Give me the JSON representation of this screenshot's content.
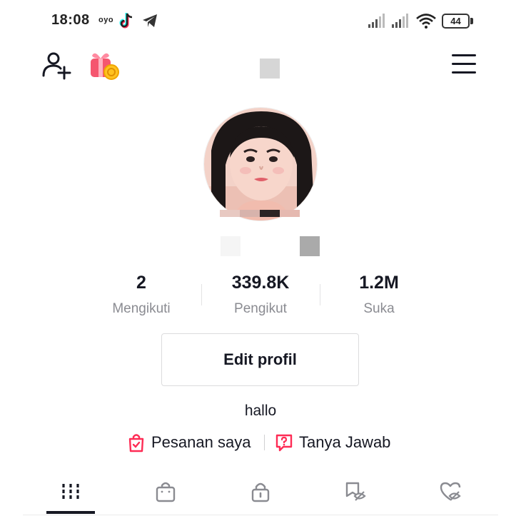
{
  "status_bar": {
    "time": "18:08",
    "carrier_badge": "oyo",
    "battery": "44"
  },
  "profile": {
    "stats": [
      {
        "value": "2",
        "label": "Mengikuti"
      },
      {
        "value": "339.8K",
        "label": "Pengikut"
      },
      {
        "value": "1.2M",
        "label": "Suka"
      }
    ],
    "edit_button": "Edit profil",
    "bio": "hallo",
    "links": [
      {
        "label": "Pesanan saya",
        "icon": "shopping-bag-check-icon"
      },
      {
        "label": "Tanya Jawab",
        "icon": "question-chat-icon"
      }
    ]
  },
  "tabs": [
    {
      "icon": "grid-videos-icon",
      "active": true
    },
    {
      "icon": "shop-bag-icon",
      "active": false
    },
    {
      "icon": "lock-icon",
      "active": false
    },
    {
      "icon": "repost-hidden-icon",
      "active": false
    },
    {
      "icon": "liked-hidden-icon",
      "active": false
    }
  ],
  "colors": {
    "accent": "#fe2c55",
    "text": "#161823",
    "secondary_text": "#8a8b91"
  }
}
